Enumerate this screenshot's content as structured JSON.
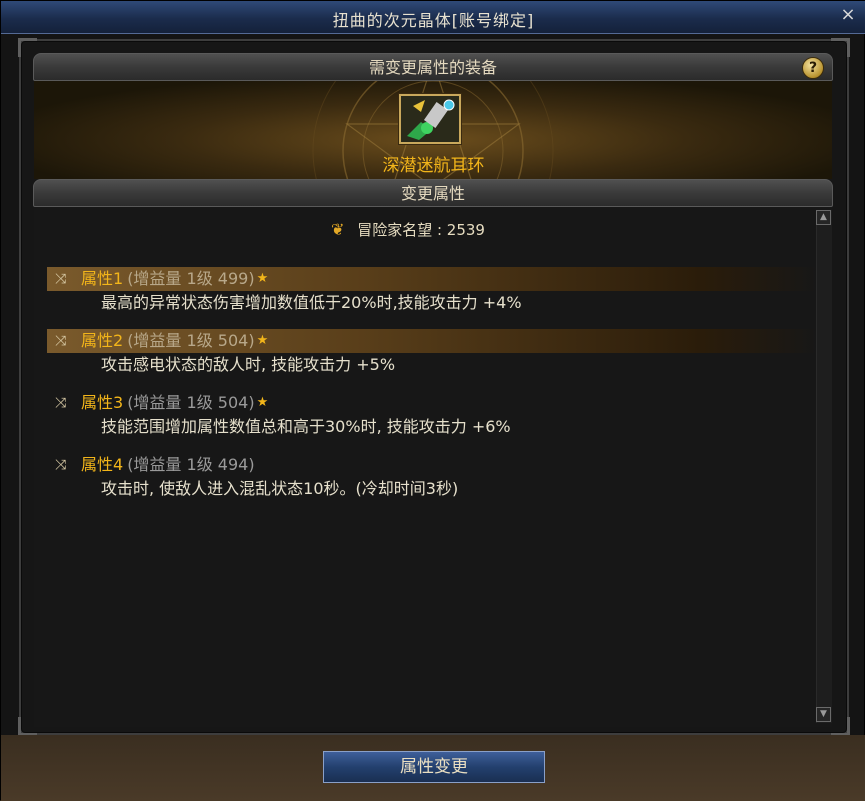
{
  "window": {
    "title": "扭曲的次元晶体[账号绑定]",
    "close_icon": "×"
  },
  "equip_section": {
    "header": "需变更属性的装备",
    "help_icon": "?",
    "item_name": "深潜迷航耳环"
  },
  "attr_section": {
    "header": "变更属性",
    "reputation_label": "冒险家名望 : 2539"
  },
  "attributes": [
    {
      "name": "属性1",
      "meta": "(增益量 1级 499)",
      "starred": true,
      "highlighted": true,
      "desc": "最高的异常状态伤害增加数值低于20%时,技能攻击力 +4%"
    },
    {
      "name": "属性2",
      "meta": "(增益量 1级 504)",
      "starred": true,
      "highlighted": true,
      "desc": "攻击感电状态的敌人时, 技能攻击力 +5%"
    },
    {
      "name": "属性3",
      "meta": "(增益量 1级 504)",
      "starred": true,
      "highlighted": false,
      "desc": "技能范围增加属性数值总和高于30%时, 技能攻击力 +6%"
    },
    {
      "name": "属性4",
      "meta": "(增益量 1级 494)",
      "starred": false,
      "highlighted": false,
      "desc": "攻击时, 使敌人进入混乱状态10秒。(冷却时间3秒)"
    }
  ],
  "icons": {
    "shuffle": "⤨",
    "star": "★",
    "reputation": "❦",
    "scroll_up": "▲",
    "scroll_down": "▼"
  },
  "actions": {
    "change_button": "属性变更"
  },
  "colors": {
    "accent_gold": "#f2b51a",
    "title_blue": "#1b2c4c"
  }
}
